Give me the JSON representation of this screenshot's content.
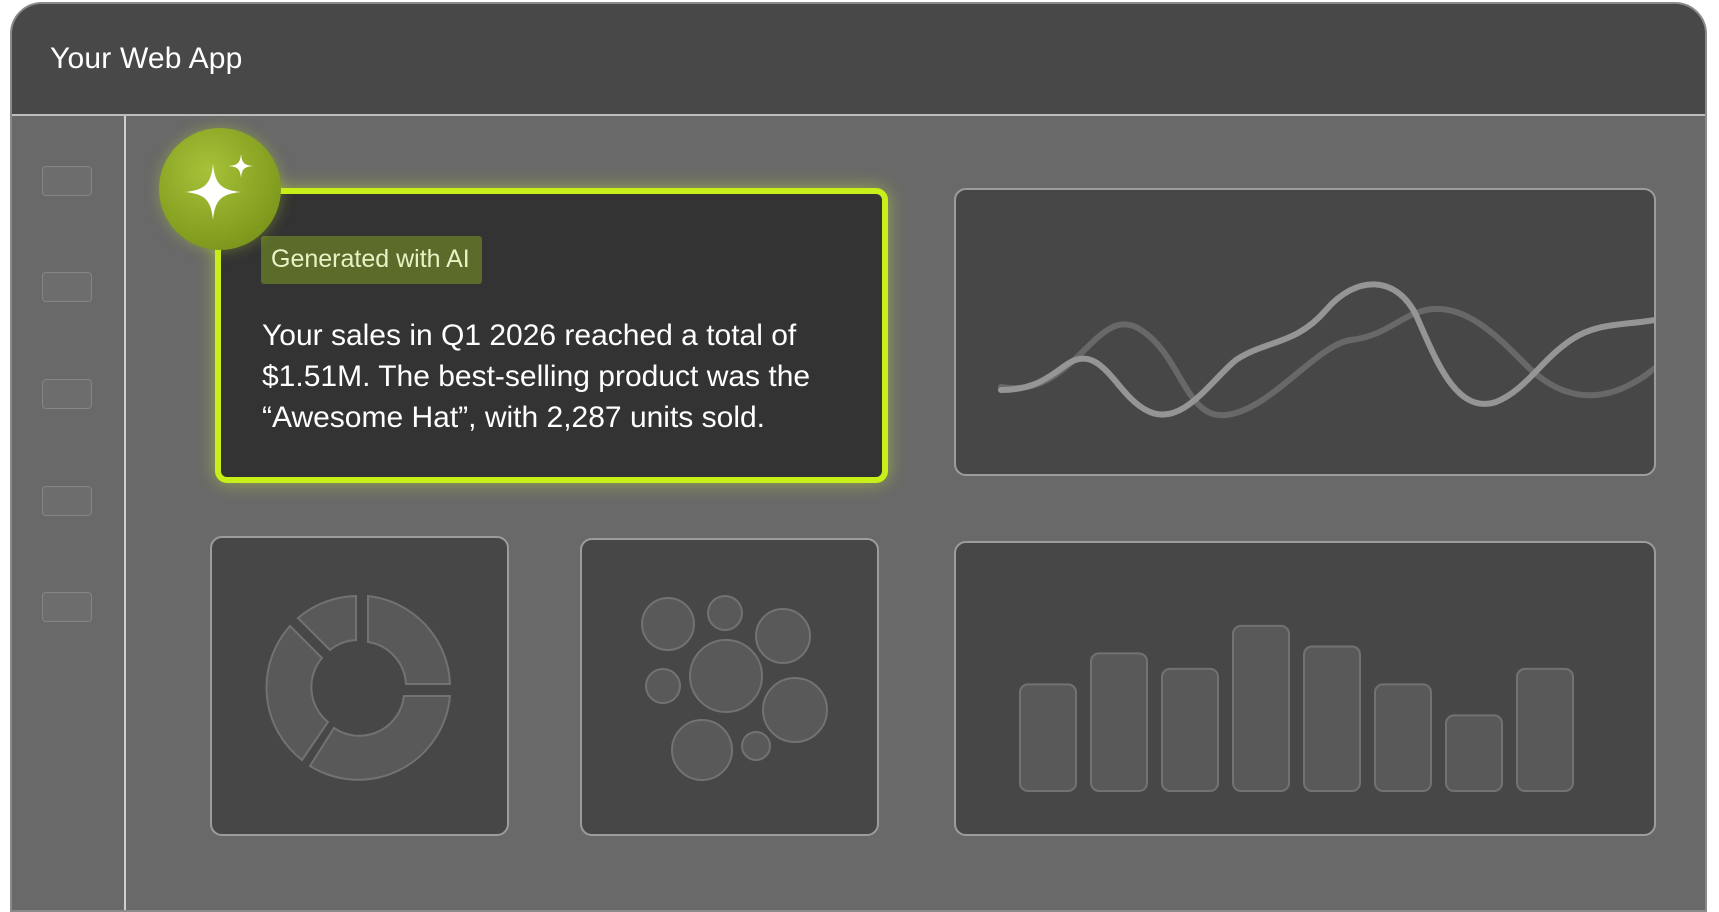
{
  "app": {
    "title": "Your Web App"
  },
  "sidebar": {
    "items": [
      {
        "id": 1
      },
      {
        "id": 2
      },
      {
        "id": 3
      },
      {
        "id": 4
      },
      {
        "id": 5
      }
    ]
  },
  "ai_card": {
    "badge": "Generated with AI",
    "summary": "Your sales in Q1 2026 reached a total of $1.51M. The best-selling product was the “Awesome Hat”, with 2,287 units sold."
  },
  "icons": {
    "ai": "sparkle-icon"
  },
  "colors": {
    "accent": "#c9ef1a",
    "badge_bg": "#5a6b2a",
    "panel": "#474747",
    "page": "#696969"
  },
  "bar_placeholder": {
    "values": [
      0.62,
      0.8,
      0.71,
      0.96,
      0.84,
      0.62,
      0.44,
      0.71
    ]
  }
}
